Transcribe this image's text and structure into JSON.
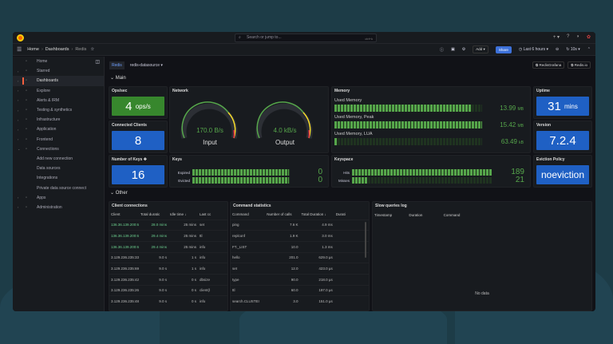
{
  "topbar": {
    "search_placeholder": "Search or jump to...",
    "shortcut": "ctrl+k"
  },
  "breadcrumb": [
    "Home",
    "Dashboards",
    "Redis"
  ],
  "toolbar": {
    "add": "Add",
    "share": "Share",
    "time_range": "Last 6 hours",
    "refresh": "10s"
  },
  "sidebar": {
    "items": [
      {
        "label": "Home",
        "icon": "home-icon"
      },
      {
        "label": "Starred",
        "icon": "star-icon"
      },
      {
        "label": "Dashboards",
        "icon": "grid-icon",
        "active": true
      },
      {
        "label": "Explore",
        "icon": "compass-icon"
      },
      {
        "label": "Alerts & IRM",
        "icon": "bell-icon"
      },
      {
        "label": "Testing & synthetics",
        "icon": "chart-icon"
      },
      {
        "label": "Infrastructure",
        "icon": "pulse-icon"
      },
      {
        "label": "Application",
        "icon": "bars-icon"
      },
      {
        "label": "Frontend",
        "icon": "frontend-icon"
      },
      {
        "label": "Connections",
        "icon": "plug-icon"
      }
    ],
    "sub": [
      "Add new connection",
      "Data sources",
      "Integrations",
      "Private data source connect"
    ],
    "bottom": [
      {
        "label": "Apps",
        "icon": "apps-icon"
      },
      {
        "label": "Administration",
        "icon": "gear-icon"
      }
    ]
  },
  "variables": {
    "label": "Redis",
    "datasource": "redis-datasource",
    "links": [
      "RedisGrafana",
      "Redis.io"
    ]
  },
  "rows": {
    "main": "Main",
    "other": "Other"
  },
  "panels": {
    "ops": {
      "title": "Ops/sec",
      "value": "4",
      "unit": "ops/s"
    },
    "clients": {
      "title": "Connected Clients",
      "value": "8"
    },
    "keys_count": {
      "title": "Number of Keys",
      "value": "16"
    },
    "network": {
      "title": "Network",
      "input": "170.0 B/s",
      "input_label": "Input",
      "output": "4.0 kB/s",
      "output_label": "Output"
    },
    "keys": {
      "title": "Keys",
      "rows": [
        {
          "label": "Expired",
          "value": "0",
          "fill": 0.99
        },
        {
          "label": "Evicted",
          "value": "0",
          "fill": 0.99
        }
      ]
    },
    "memory": {
      "title": "Memory",
      "rows": [
        {
          "label": "Used Memory",
          "value": "13.99",
          "unit": "MB",
          "fill": 0.93
        },
        {
          "label": "Used Memory, Peak",
          "value": "15.42",
          "unit": "MB",
          "fill": 1.0
        },
        {
          "label": "Used Memory, LUA",
          "value": "63.49",
          "unit": "kB",
          "fill": 0.02
        }
      ]
    },
    "keyspace": {
      "title": "Keyspace",
      "rows": [
        {
          "label": "Hits",
          "value": "189",
          "fill": 1.0
        },
        {
          "label": "Misses",
          "value": "21",
          "fill": 0.11
        }
      ]
    },
    "uptime": {
      "title": "Uptime",
      "value": "31",
      "unit": "mins"
    },
    "version": {
      "title": "Version",
      "value": "7.2.4"
    },
    "eviction": {
      "title": "Eviction Policy",
      "value": "noeviction"
    }
  },
  "client_connections": {
    "title": "Client connections",
    "columns": [
      "Client",
      "Total duratic",
      "Idle time ↓",
      "Last cc"
    ],
    "rows": [
      [
        "136.36.139.200:63",
        "28.0 mins",
        "25 mins",
        "set"
      ],
      [
        "136.36.139.200:63",
        "29.4 mins",
        "25 mins",
        "ttl"
      ],
      [
        "136.36.139.200:63",
        "29.4 mins",
        "25 mins",
        "info"
      ],
      [
        "3.129.236.235:33",
        "9.0 s",
        "1 s",
        "info"
      ],
      [
        "3.129.236.235:69",
        "9.0 s",
        "1 s",
        "info"
      ],
      [
        "3.129.236.235:42",
        "9.0 s",
        "0 s",
        "dbsize"
      ],
      [
        "3.129.236.235:26",
        "9.0 s",
        "0 s",
        "client(l"
      ],
      [
        "3.129.236.235:48",
        "9.0 s",
        "0 s",
        "info"
      ]
    ]
  },
  "command_stats": {
    "title": "Command statistics",
    "columns": [
      "Command",
      "Number of calls",
      "Total Duration ↓",
      "Durati"
    ],
    "rows": [
      [
        "ping",
        "7.6 K",
        "4.9 ms"
      ],
      [
        "replconf",
        "1.9 K",
        "3.0 ms"
      ],
      [
        "FT._LIST",
        "10.0",
        "1.3 ms"
      ],
      [
        "hello",
        "201.0",
        "629.0 µs"
      ],
      [
        "set",
        "12.0",
        "423.0 µs"
      ],
      [
        "type",
        "90.0",
        "218.0 µs"
      ],
      [
        "ttl",
        "60.0",
        "197.0 µs"
      ],
      [
        "search.CLUSTEI",
        "3.0",
        "151.0 µs"
      ]
    ]
  },
  "slow_queries": {
    "title": "Slow queries log",
    "columns": [
      "Timestamp",
      "Duration",
      "Command"
    ],
    "empty": "No data"
  }
}
